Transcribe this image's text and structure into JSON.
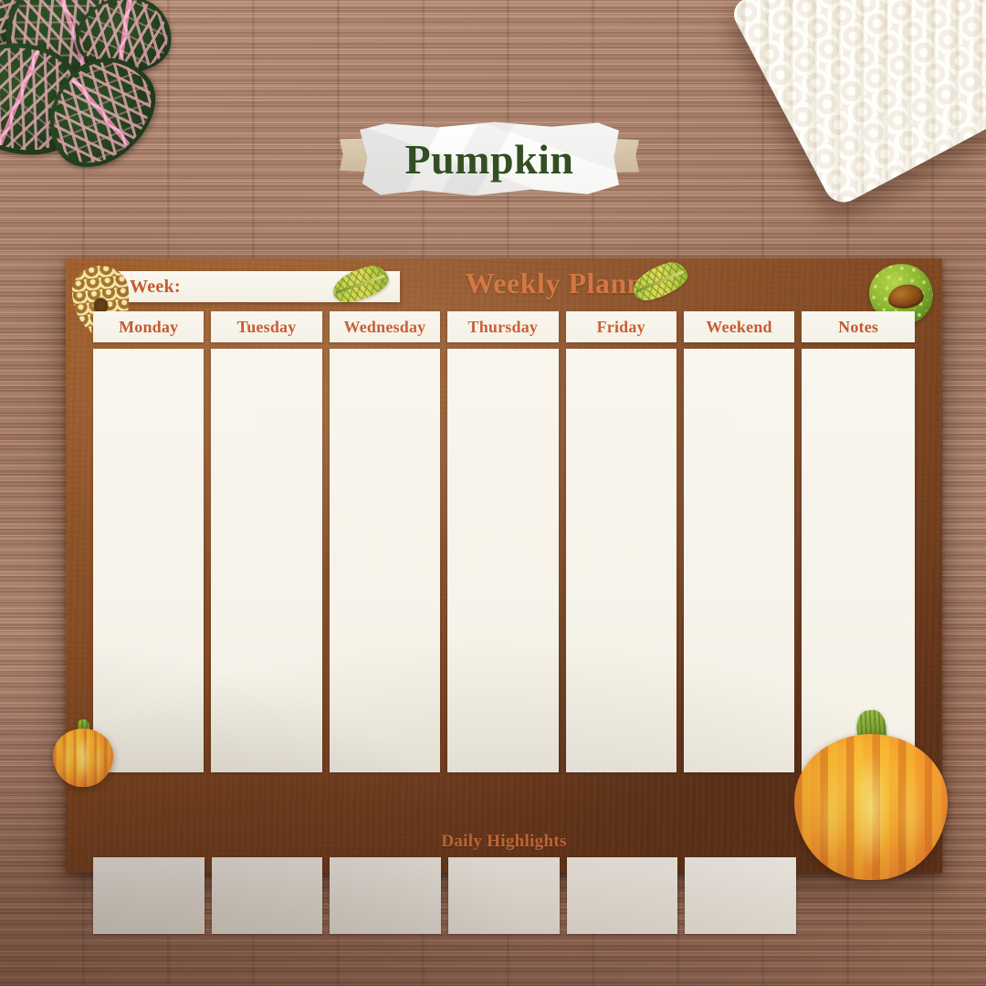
{
  "title_card": {
    "text": "Pumpkin"
  },
  "planner": {
    "header": {
      "week_label": "Week:",
      "week_value": "",
      "title": "Weekly Planner"
    },
    "columns": [
      {
        "label": "Monday",
        "value": ""
      },
      {
        "label": "Tuesday",
        "value": ""
      },
      {
        "label": "Wednesday",
        "value": ""
      },
      {
        "label": "Thursday",
        "value": ""
      },
      {
        "label": "Friday",
        "value": ""
      },
      {
        "label": "Weekend",
        "value": ""
      },
      {
        "label": "Notes",
        "value": ""
      }
    ],
    "daily_highlights": {
      "label": "Daily Highlights",
      "cells": [
        "",
        "",
        "",
        "",
        "",
        ""
      ]
    }
  },
  "decorations": [
    {
      "name": "pinecone",
      "position": "planner-top-left"
    },
    {
      "name": "autumn-leaf",
      "position": "header-left"
    },
    {
      "name": "autumn-leaf",
      "position": "header-right"
    },
    {
      "name": "chestnut-conker",
      "position": "planner-top-right"
    },
    {
      "name": "pumpkin-large",
      "position": "planner-bottom-right"
    },
    {
      "name": "pumpkin-small",
      "position": "planner-left-edge"
    },
    {
      "name": "fittonia-plant",
      "position": "scene-top-left"
    },
    {
      "name": "knit-blanket",
      "position": "scene-top-right"
    }
  ],
  "colors": {
    "planner_brown": "#7d4520",
    "accent_orange": "#c4572a",
    "title_orange": "#d1703a",
    "paper_cream": "#f9f6ee",
    "title_green": "#2d4a1e",
    "tape_tan": "#d6c3a5",
    "pumpkin_orange": "#f0912f",
    "wood_backdrop": "#b98d75"
  }
}
